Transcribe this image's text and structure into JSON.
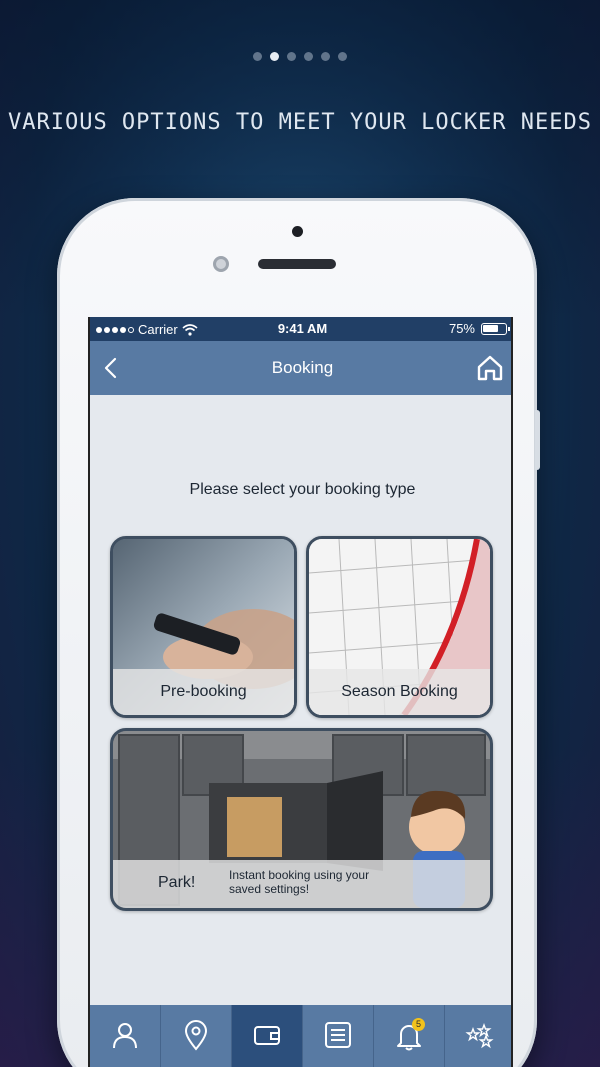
{
  "pager": {
    "total": 6,
    "active_index": 1
  },
  "headline": "Various options to meet your locker needs",
  "status_bar": {
    "carrier": "Carrier",
    "time": "9:41 AM",
    "battery_percent": "75%",
    "battery_level": 0.75
  },
  "nav": {
    "title": "Booking"
  },
  "prompt": "Please select your booking type",
  "options": {
    "pre_booking": {
      "label": "Pre-booking",
      "icon": "phone-in-hand-photo"
    },
    "season_booking": {
      "label": "Season Booking",
      "icon": "calendar-photo"
    },
    "park": {
      "label": "Park!",
      "description": "Instant booking using your saved settings!",
      "icon": "locker-photo"
    }
  },
  "tabbar": {
    "tabs": [
      {
        "name": "profile",
        "icon": "user-icon"
      },
      {
        "name": "locations",
        "icon": "map-pin-icon"
      },
      {
        "name": "wallet",
        "icon": "wallet-icon",
        "active": true
      },
      {
        "name": "bookings",
        "icon": "locker-list-icon"
      },
      {
        "name": "notifications",
        "icon": "bell-icon",
        "badge": "5"
      },
      {
        "name": "rewards",
        "icon": "stars-icon"
      }
    ]
  },
  "colors": {
    "nav_bar": "#587aa3",
    "status_bar": "#213f66",
    "active_tab": "#2c4f7c",
    "badge": "#f2c21b",
    "screen_bg": "#e5e9ee"
  }
}
